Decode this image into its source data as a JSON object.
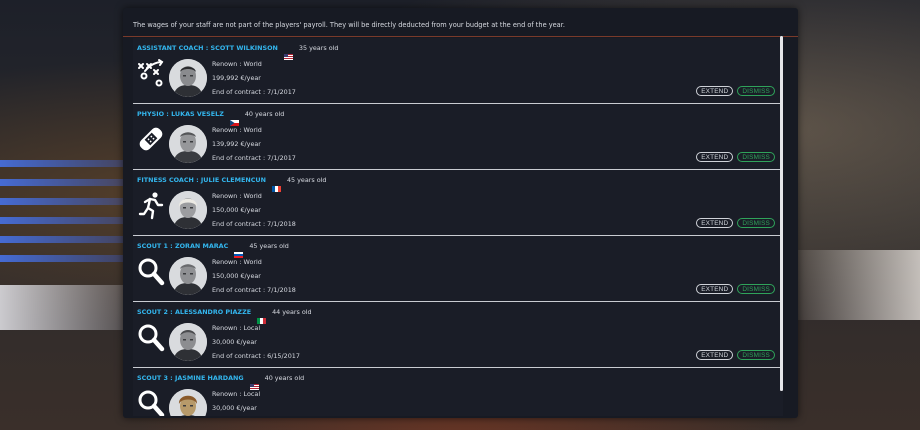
{
  "notice": "The wages of your staff are not part of the players' payroll. They will be directly deducted from your budget at the end of the year.",
  "buttons": {
    "extend": "EXTEND",
    "dismiss": "DISMISS"
  },
  "staff": [
    {
      "title": "ASSISTANT COACH : SCOTT WILKINSON",
      "flag": "usa-flag",
      "age": "35 years old",
      "renown": "Renown : World",
      "wage": "199,992 €/year",
      "contract": "End of contract : 7/1/2017",
      "icon": "playbook-icon"
    },
    {
      "title": "PHYSIO : LUKAS VESELZ",
      "flag": "czech-flag",
      "age": "40 years old",
      "renown": "Renown : World",
      "wage": "139,992 €/year",
      "contract": "End of contract : 7/1/2017",
      "icon": "bandage-icon"
    },
    {
      "title": "FITNESS COACH : JULIE CLEMENCUN",
      "flag": "france-flag",
      "age": "45 years old",
      "renown": "Renown : World",
      "wage": "150,000 €/year",
      "contract": "End of contract : 7/1/2018",
      "icon": "runner-icon"
    },
    {
      "title": "SCOUT 1 : ZORAN MARAC",
      "flag": "slovenia-flag",
      "age": "45 years old",
      "renown": "Renown : World",
      "wage": "150,000 €/year",
      "contract": "End of contract : 7/1/2018",
      "icon": "magnifier-icon"
    },
    {
      "title": "SCOUT 2 : ALESSANDRO PIAZZE",
      "flag": "italy-flag",
      "age": "44 years old",
      "renown": "Renown : Local",
      "wage": "30,000 €/year",
      "contract": "End of contract : 6/15/2017",
      "icon": "magnifier-icon"
    },
    {
      "title": "SCOUT 3 : JASMINE HARDANG",
      "flag": "usa-flag",
      "age": "40 years old",
      "renown": "Renown : Local",
      "wage": "30,000 €/year",
      "contract": "",
      "icon": "magnifier-icon"
    }
  ],
  "colors": {
    "accent": "#33b6ee",
    "dismiss": "#2fa35a",
    "panel": "#171a23"
  }
}
